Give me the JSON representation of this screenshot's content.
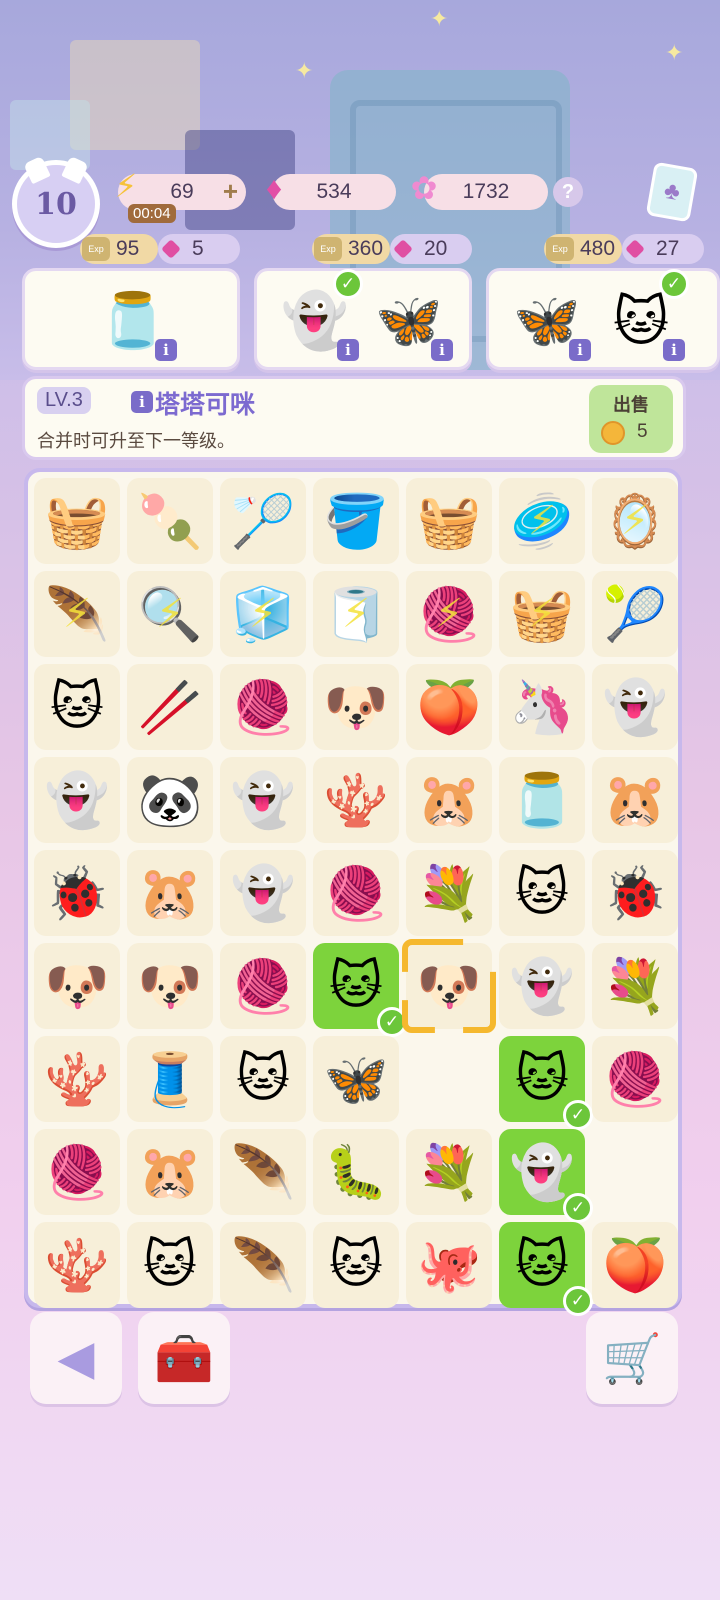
{
  "hud": {
    "level": "10",
    "energy": {
      "value": "69",
      "timer": "00:04",
      "icon": "lightning-bolt-icon",
      "plus": "+"
    },
    "gems": {
      "value": "534",
      "icon": "pink-gem-icon"
    },
    "stars": {
      "value": "1732",
      "icon": "rainbow-star-icon"
    },
    "help": "?"
  },
  "orders": [
    {
      "energy": "95",
      "gems": "5",
      "items": [
        {
          "icon": "firefly-jar",
          "glyph": "🫙"
        }
      ]
    },
    {
      "energy": "360",
      "gems": "20",
      "items": [
        {
          "icon": "ghost-cloud",
          "glyph": "👻",
          "done": true
        },
        {
          "icon": "purple-butterfly",
          "glyph": "🦋"
        }
      ]
    },
    {
      "energy": "480",
      "gems": "27",
      "items": [
        {
          "icon": "purple-butterfly",
          "glyph": "🦋"
        },
        {
          "icon": "orange-cat",
          "glyph": "🐱",
          "done": true
        }
      ]
    }
  ],
  "info_panel": {
    "level": "LV.3",
    "name": "塔塔可咪",
    "description": "合并时可升至下一等级。",
    "sell_label": "出售",
    "sell_price": "5"
  },
  "board": [
    [
      {
        "g": "🧺"
      },
      {
        "g": "🍡"
      },
      {
        "g": "🏸"
      },
      {
        "g": "🪣"
      },
      {
        "g": "🧺"
      },
      {
        "g": "🥏",
        "bolt": true
      },
      {
        "g": "🪞",
        "bolt": true
      }
    ],
    [
      {
        "g": "🪶",
        "bolt": true
      },
      {
        "g": "🔍",
        "bolt": true
      },
      {
        "g": "🧊",
        "bolt": true
      },
      {
        "g": "🧻",
        "bolt": true
      },
      {
        "g": "🧶",
        "bolt": true
      },
      {
        "g": "🧺",
        "bolt": true
      },
      {
        "g": "🎾"
      }
    ],
    [
      {
        "g": "🐱"
      },
      {
        "g": "🥢"
      },
      {
        "g": "🧶"
      },
      {
        "g": "🐶"
      },
      {
        "g": "🍑"
      },
      {
        "g": "🦄"
      },
      {
        "g": "👻"
      }
    ],
    [
      {
        "g": "👻"
      },
      {
        "g": "🐼"
      },
      {
        "g": "👻"
      },
      {
        "g": "🪸"
      },
      {
        "g": "🐹"
      },
      {
        "g": "🫙"
      },
      {
        "g": "🐹"
      }
    ],
    [
      {
        "g": "🐞"
      },
      {
        "g": "🐹"
      },
      {
        "g": "👻"
      },
      {
        "g": "🧶"
      },
      {
        "g": "💐"
      },
      {
        "g": "🐱"
      },
      {
        "g": "🐞"
      }
    ],
    [
      {
        "g": "🐶"
      },
      {
        "g": "🐶"
      },
      {
        "g": "🧶"
      },
      {
        "g": "🐱",
        "done": true
      },
      {
        "g": "🐶",
        "selected": true
      },
      {
        "g": "👻"
      },
      {
        "g": "💐"
      }
    ],
    [
      {
        "g": "🪸"
      },
      {
        "g": "🧵"
      },
      {
        "g": "🐱"
      },
      {
        "g": "🦋"
      },
      {
        "g": ""
      },
      {
        "g": "🐱",
        "done": true
      },
      {
        "g": "🧶"
      }
    ],
    [
      {
        "g": "🧶"
      },
      {
        "g": "🐹"
      },
      {
        "g": "🪶"
      },
      {
        "g": "🐛"
      },
      {
        "g": "💐"
      },
      {
        "g": "👻",
        "done": true
      },
      {
        "g": ""
      }
    ],
    [
      {
        "g": "🪸"
      },
      {
        "g": "🐱"
      },
      {
        "g": "🪶"
      },
      {
        "g": "🐱"
      },
      {
        "g": "🐙"
      },
      {
        "g": "🐱",
        "done": true
      },
      {
        "g": "🍑"
      }
    ]
  ],
  "bottom": {
    "back_icon": "back-arrow-icon",
    "toolbox_icon": "toolbox-icon",
    "shop_icon": "shopping-cart-icon"
  }
}
